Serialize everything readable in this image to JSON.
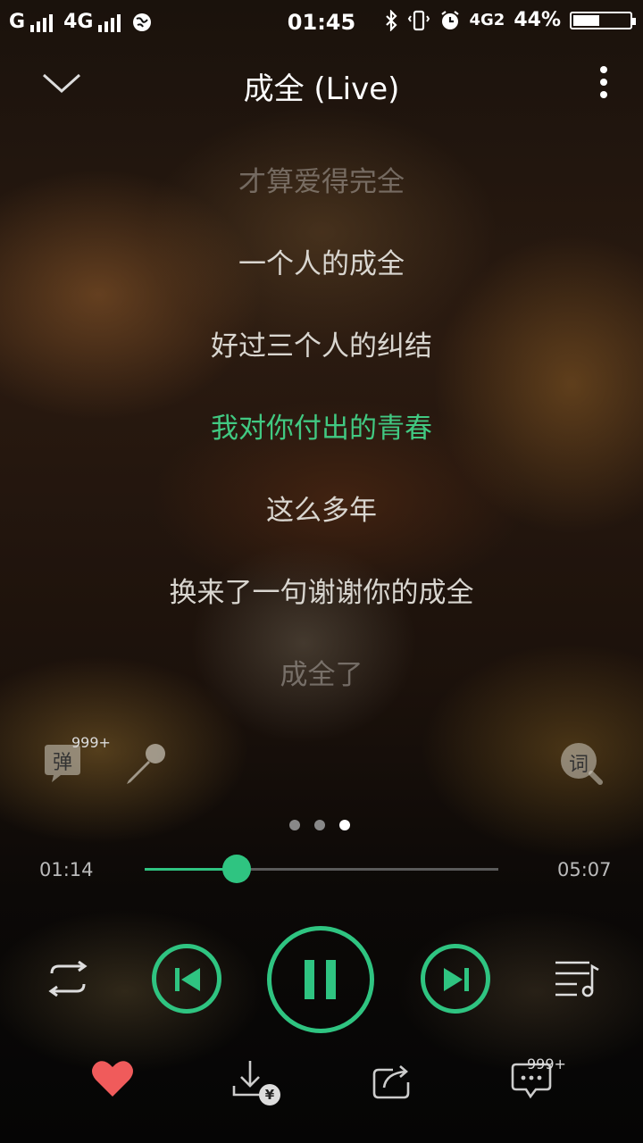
{
  "status_bar": {
    "carrier1": "G",
    "carrier2": "4G",
    "network2": "4G2",
    "time": "01:45",
    "battery": "44%"
  },
  "header": {
    "title": "成全 (Live)"
  },
  "lyrics": {
    "line1": "才算爱得完全",
    "line2": "一个人的成全",
    "line3": "好过三个人的纠结",
    "line4": "我对你付出的青春",
    "line5": "这么多年",
    "line6": "换来了一句谢谢你的成全",
    "line7": "成全了"
  },
  "tools": {
    "danmaku_label": "弹",
    "danmaku_count": "999+",
    "lyrics_search_label": "词"
  },
  "pager": {
    "pages": 3,
    "current": 3
  },
  "progress": {
    "elapsed": "01:14",
    "total": "05:07",
    "fraction": 0.26
  },
  "bottom": {
    "comment_count": "999+",
    "paid_mark": "¥"
  },
  "colors": {
    "accent": "#2fc481",
    "like": "#f05b5b"
  }
}
